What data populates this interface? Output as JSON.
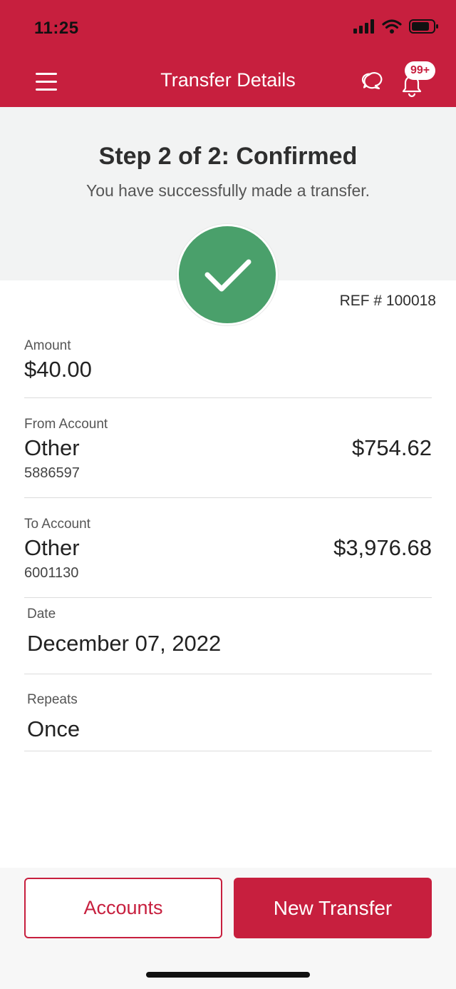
{
  "status_bar": {
    "time": "11:25"
  },
  "navbar": {
    "title": "Transfer Details",
    "notification_badge": "99+"
  },
  "hero": {
    "title": "Step 2 of 2: Confirmed",
    "subtitle": "You have successfully made a transfer."
  },
  "reference": "REF # 100018",
  "amount": {
    "label": "Amount",
    "value": "$40.00"
  },
  "from_account": {
    "label": "From Account",
    "name": "Other",
    "number": "5886597",
    "balance": "$754.62"
  },
  "to_account": {
    "label": "To Account",
    "name": "Other",
    "number": "6001130",
    "balance": "$3,976.68"
  },
  "date": {
    "label": "Date",
    "value": "December 07, 2022"
  },
  "repeats": {
    "label": "Repeats",
    "value": "Once"
  },
  "footer": {
    "accounts_label": "Accounts",
    "new_transfer_label": "New Transfer"
  },
  "colors": {
    "brand": "#c71f3e",
    "success": "#4aa06b",
    "hero_bg": "#f2f3f3"
  }
}
